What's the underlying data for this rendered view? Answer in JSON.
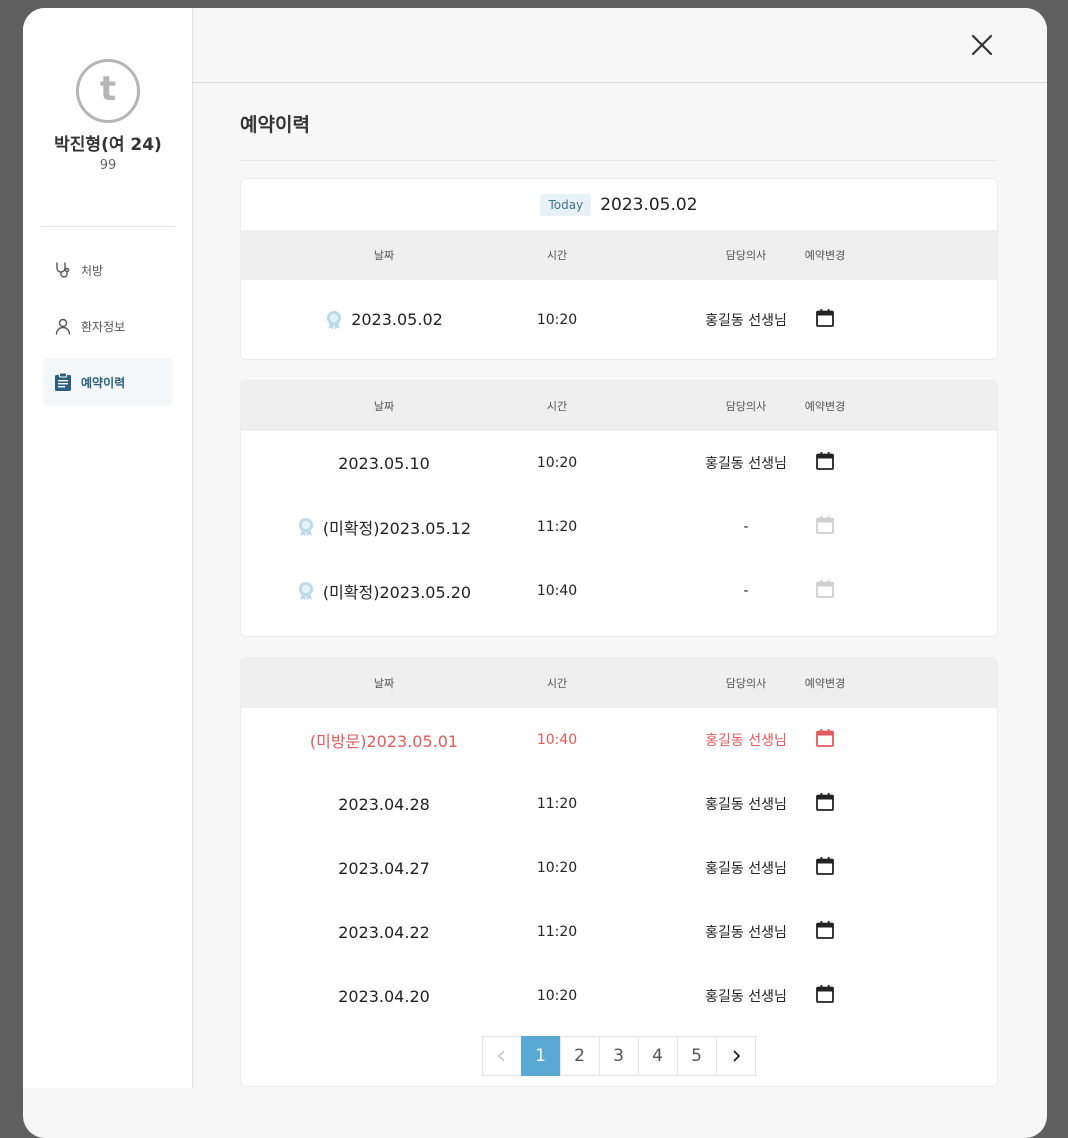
{
  "patient": {
    "avatar_letter": "t",
    "name": "박진형(여 24)",
    "id": "99"
  },
  "nav": [
    {
      "label": "처방",
      "icon": "stethoscope-icon"
    },
    {
      "label": "환자정보",
      "icon": "person-icon"
    },
    {
      "label": "예약이력",
      "icon": "clipboard-icon",
      "active": true
    }
  ],
  "section_title": "예약이력",
  "today": {
    "badge": "Today",
    "date": "2023.05.02"
  },
  "columns": {
    "date": "날짜",
    "time": "시간",
    "doctor": "담당의사",
    "change": "예약변경"
  },
  "today_rows": [
    {
      "date": "2023.05.02",
      "time": "10:20",
      "doctor": "홍길동 선생님",
      "medal": true,
      "calendar": "enabled"
    }
  ],
  "upcoming_rows": [
    {
      "date": "2023.05.10",
      "time": "10:20",
      "doctor": "홍길동 선생님",
      "medal": false,
      "calendar": "enabled"
    },
    {
      "date": "(미확정)2023.05.12",
      "time": "11:20",
      "doctor": "-",
      "medal": true,
      "calendar": "disabled"
    },
    {
      "date": "(미확정)2023.05.20",
      "time": "10:40",
      "doctor": "-",
      "medal": true,
      "calendar": "disabled"
    }
  ],
  "past_rows": [
    {
      "date": "(미방문)2023.05.01",
      "time": "10:40",
      "doctor": "홍길동 선생님",
      "medal": false,
      "calendar": "missed"
    },
    {
      "date": "2023.04.28",
      "time": "11:20",
      "doctor": "홍길동 선생님",
      "medal": false,
      "calendar": "enabled"
    },
    {
      "date": "2023.04.27",
      "time": "10:20",
      "doctor": "홍길동 선생님",
      "medal": false,
      "calendar": "enabled"
    },
    {
      "date": "2023.04.22",
      "time": "11:20",
      "doctor": "홍길동 선생님",
      "medal": false,
      "calendar": "enabled"
    },
    {
      "date": "2023.04.20",
      "time": "10:20",
      "doctor": "홍길동 선생님",
      "medal": false,
      "calendar": "enabled"
    }
  ],
  "pagination": {
    "pages": [
      "1",
      "2",
      "3",
      "4",
      "5"
    ],
    "current": "1"
  },
  "colors": {
    "accent": "#5aa9d4",
    "missed": "#e35b5b",
    "nav_active": "#2e5f82",
    "calendar_disabled": "#cfcfcf"
  }
}
